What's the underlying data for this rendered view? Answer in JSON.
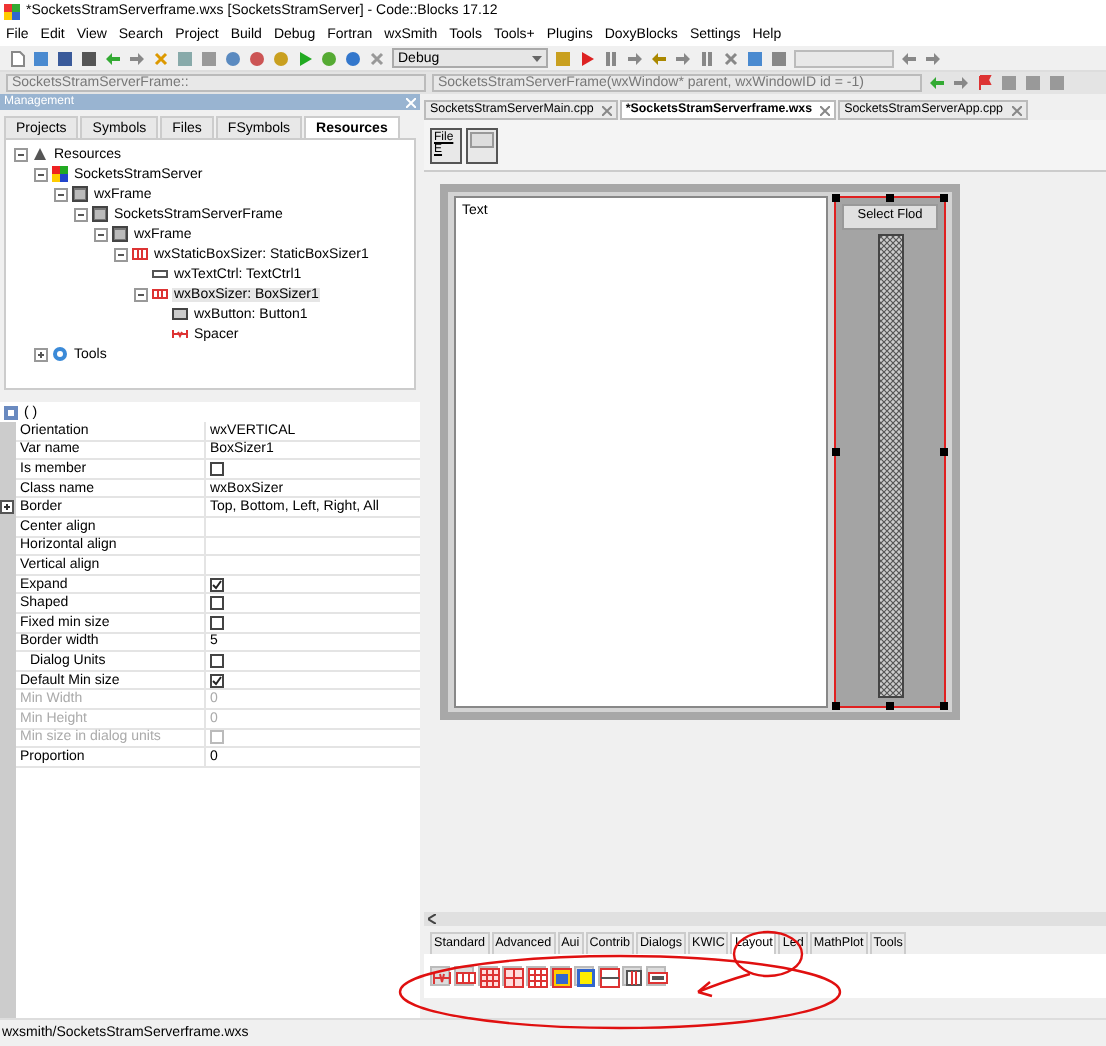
{
  "window": {
    "title": "*SocketsStramServerframe.wxs [SocketsStramServer] - Code::Blocks 17.12"
  },
  "menu": [
    "File",
    "Edit",
    "View",
    "Search",
    "Project",
    "Build",
    "Debug",
    "Fortran",
    "wxSmith",
    "Tools",
    "Tools+",
    "Plugins",
    "DoxyBlocks",
    "Settings",
    "Help"
  ],
  "toolbar": {
    "build_target": "Debug"
  },
  "code_bar": {
    "scope": "SocketsStramServerFrame::",
    "function": "SocketsStramServerFrame(wxWindow* parent, wxWindowID id = -1)"
  },
  "management": {
    "title": "Management",
    "tabs": [
      {
        "label": "Projects",
        "selected": false
      },
      {
        "label": "Symbols",
        "selected": false
      },
      {
        "label": "Files",
        "selected": false
      },
      {
        "label": "FSymbols",
        "selected": false
      },
      {
        "label": "Resources",
        "selected": true
      }
    ],
    "tree": [
      {
        "label": "Resources",
        "kind": "resources",
        "selected": false,
        "expanded": true,
        "children": [
          {
            "label": "SocketsStramServer",
            "kind": "project",
            "selected": false,
            "expanded": true,
            "children": [
              {
                "label": "wxFrame",
                "kind": "frame",
                "selected": false,
                "expanded": true,
                "children": [
                  {
                    "label": "SocketsStramServerFrame",
                    "kind": "frame",
                    "selected": false,
                    "expanded": true,
                    "children": [
                      {
                        "label": "wxFrame",
                        "kind": "frame",
                        "selected": false,
                        "expanded": true,
                        "children": [
                          {
                            "label": "wxStaticBoxSizer: StaticBoxSizer1",
                            "kind": "staticsizer",
                            "selected": false,
                            "expanded": true,
                            "children": [
                              {
                                "label": "wxTextCtrl: TextCtrl1",
                                "kind": "textctrl",
                                "selected": false
                              },
                              {
                                "label": "wxBoxSizer: BoxSizer1",
                                "kind": "sizer",
                                "selected": true,
                                "expanded": true,
                                "children": [
                                  {
                                    "label": "wxButton: Button1",
                                    "kind": "button",
                                    "selected": false
                                  },
                                  {
                                    "label": "Spacer",
                                    "kind": "spacer",
                                    "selected": false
                                  }
                                ]
                              }
                            ]
                          }
                        ]
                      }
                    ]
                  }
                ]
              }
            ]
          },
          {
            "label": "Tools",
            "kind": "tools",
            "selected": false,
            "expanded": false
          }
        ]
      }
    ]
  },
  "properties": {
    "header": "( )",
    "rows": [
      {
        "name": "Orientation",
        "kind": "text",
        "value": "wxVERTICAL",
        "disabled": false
      },
      {
        "name": "Var name",
        "kind": "text",
        "value": "BoxSizer1",
        "disabled": false
      },
      {
        "name": "Is member",
        "kind": "check",
        "checked": false,
        "disabled": false
      },
      {
        "name": "Class name",
        "kind": "text",
        "value": "wxBoxSizer",
        "disabled": false
      },
      {
        "name": "Border",
        "kind": "text",
        "value": "Top, Bottom, Left, Right, All",
        "disabled": false,
        "expanded": false
      },
      {
        "name": "Center align",
        "kind": "text",
        "disabled": false
      },
      {
        "name": "Horizontal align",
        "kind": "text",
        "disabled": false
      },
      {
        "name": "Vertical align",
        "kind": "text",
        "disabled": false
      },
      {
        "name": "Expand",
        "kind": "check",
        "checked": true,
        "disabled": false
      },
      {
        "name": "Shaped",
        "kind": "check",
        "checked": false,
        "disabled": false
      },
      {
        "name": "Fixed min size",
        "kind": "check",
        "checked": false,
        "disabled": false
      },
      {
        "name": "Border width",
        "kind": "text",
        "value": "5",
        "disabled": false,
        "children": [
          {
            "name": "Dialog Units",
            "kind": "check",
            "checked": false,
            "disabled": false
          }
        ]
      },
      {
        "name": "Default Min size",
        "kind": "check",
        "checked": true,
        "disabled": false
      },
      {
        "name": "Min Width",
        "kind": "text",
        "value": "0",
        "disabled": true
      },
      {
        "name": "Min Height",
        "kind": "text",
        "value": "0",
        "disabled": true
      },
      {
        "name": "Min size in dialog units",
        "kind": "check",
        "checked": false,
        "disabled": true
      },
      {
        "name": "Proportion",
        "kind": "text",
        "value": "0",
        "disabled": false
      }
    ]
  },
  "editor": {
    "tabs": [
      {
        "label": "SocketsStramServerMain.cpp",
        "selected": false
      },
      {
        "label": "*SocketsStramServerframe.wxs",
        "selected": true
      },
      {
        "label": "SocketsStramServerApp.cpp",
        "selected": false
      }
    ],
    "designer_button": "File E",
    "form": {
      "text_ctrl": "Text",
      "button": "Select Flod"
    }
  },
  "palette": {
    "tabs": [
      {
        "label": "Standard",
        "selected": false
      },
      {
        "label": "Advanced",
        "selected": false
      },
      {
        "label": "Aui",
        "selected": false
      },
      {
        "label": "Contrib",
        "selected": false
      },
      {
        "label": "Dialogs",
        "selected": false
      },
      {
        "label": "KWIC",
        "selected": false
      },
      {
        "label": "Layout",
        "selected": true
      },
      {
        "label": "Led",
        "selected": false
      },
      {
        "label": "MathPlot",
        "selected": false
      },
      {
        "label": "Tools",
        "selected": false
      }
    ]
  },
  "status_bar": {
    "path": "wxsmith/SocketsStramServerframe.wxs"
  }
}
